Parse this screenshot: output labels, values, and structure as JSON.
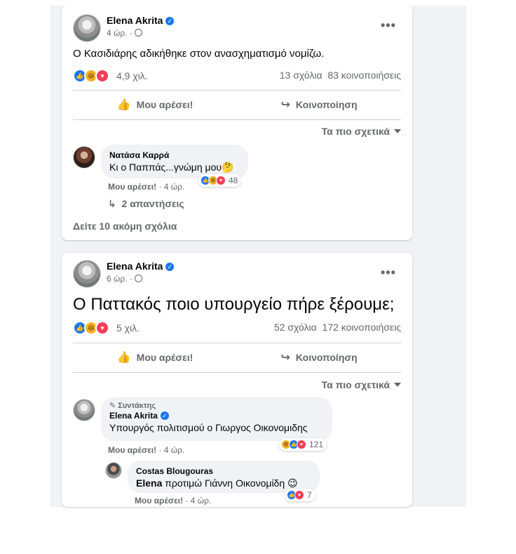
{
  "sort_label": "Τα πιο σχετικά",
  "like_action": "Μου αρέσει!",
  "share_action": "Κοινοποίηση",
  "post1": {
    "author": "Elena Akrita",
    "time": "4 ώρ.",
    "text": "Ο Κασιδιάρης αδικήθηκε στον ανασχηματισμό νομίζω.",
    "reaction_count": "4,9 χιλ.",
    "comments": "13 σχόλια",
    "shares": "83 κοινοποιήσεις",
    "comment": {
      "author": "Νατάσα Καρρά",
      "text": "Κι ο Παππάς...γνώμη μου",
      "emoji": "🤔",
      "like": "Μου αρέσει!",
      "time": "· 4 ώρ.",
      "reactions": "48"
    },
    "replies": "2 απαντήσεις",
    "more_comments": "Δείτε 10 ακόμη σχόλια"
  },
  "post2": {
    "author": "Elena Akrita",
    "time": "6 ώρ.",
    "text": "Ο Παττακός ποιο υπουργείο πήρε ξέρουμε;",
    "reaction_count": "5 χιλ.",
    "comments": "52 σχόλια",
    "shares": "172 κοινοποιήσεις",
    "comment": {
      "badge": "Συντάκτης",
      "author": "Elena Akrita",
      "text": "Υπουργός πολιτισμού ο Γιωργος Οικονομιδης",
      "like": "Μου αρέσει!",
      "time": "· 4 ώρ.",
      "reactions": "121"
    },
    "reply": {
      "author": "Costas Blougouras",
      "mention": "Elena",
      "text": " προτιμώ Γιάννη Οικονομίδη",
      "emoji": "😉",
      "like": "Μου αρέσει!",
      "time": "· 4 ώρ.",
      "reactions": "7"
    }
  },
  "colors": {
    "accent": "#1877f2",
    "love": "#f33e58",
    "haha": "#f7b125",
    "muted": "#65676b"
  },
  "icons": [
    "like-icon",
    "haha-icon",
    "love-icon",
    "thumbs-up-icon",
    "share-arrow-icon",
    "globe-icon",
    "more-icon",
    "reply-arrow-icon",
    "pencil-icon",
    "verified-icon"
  ]
}
